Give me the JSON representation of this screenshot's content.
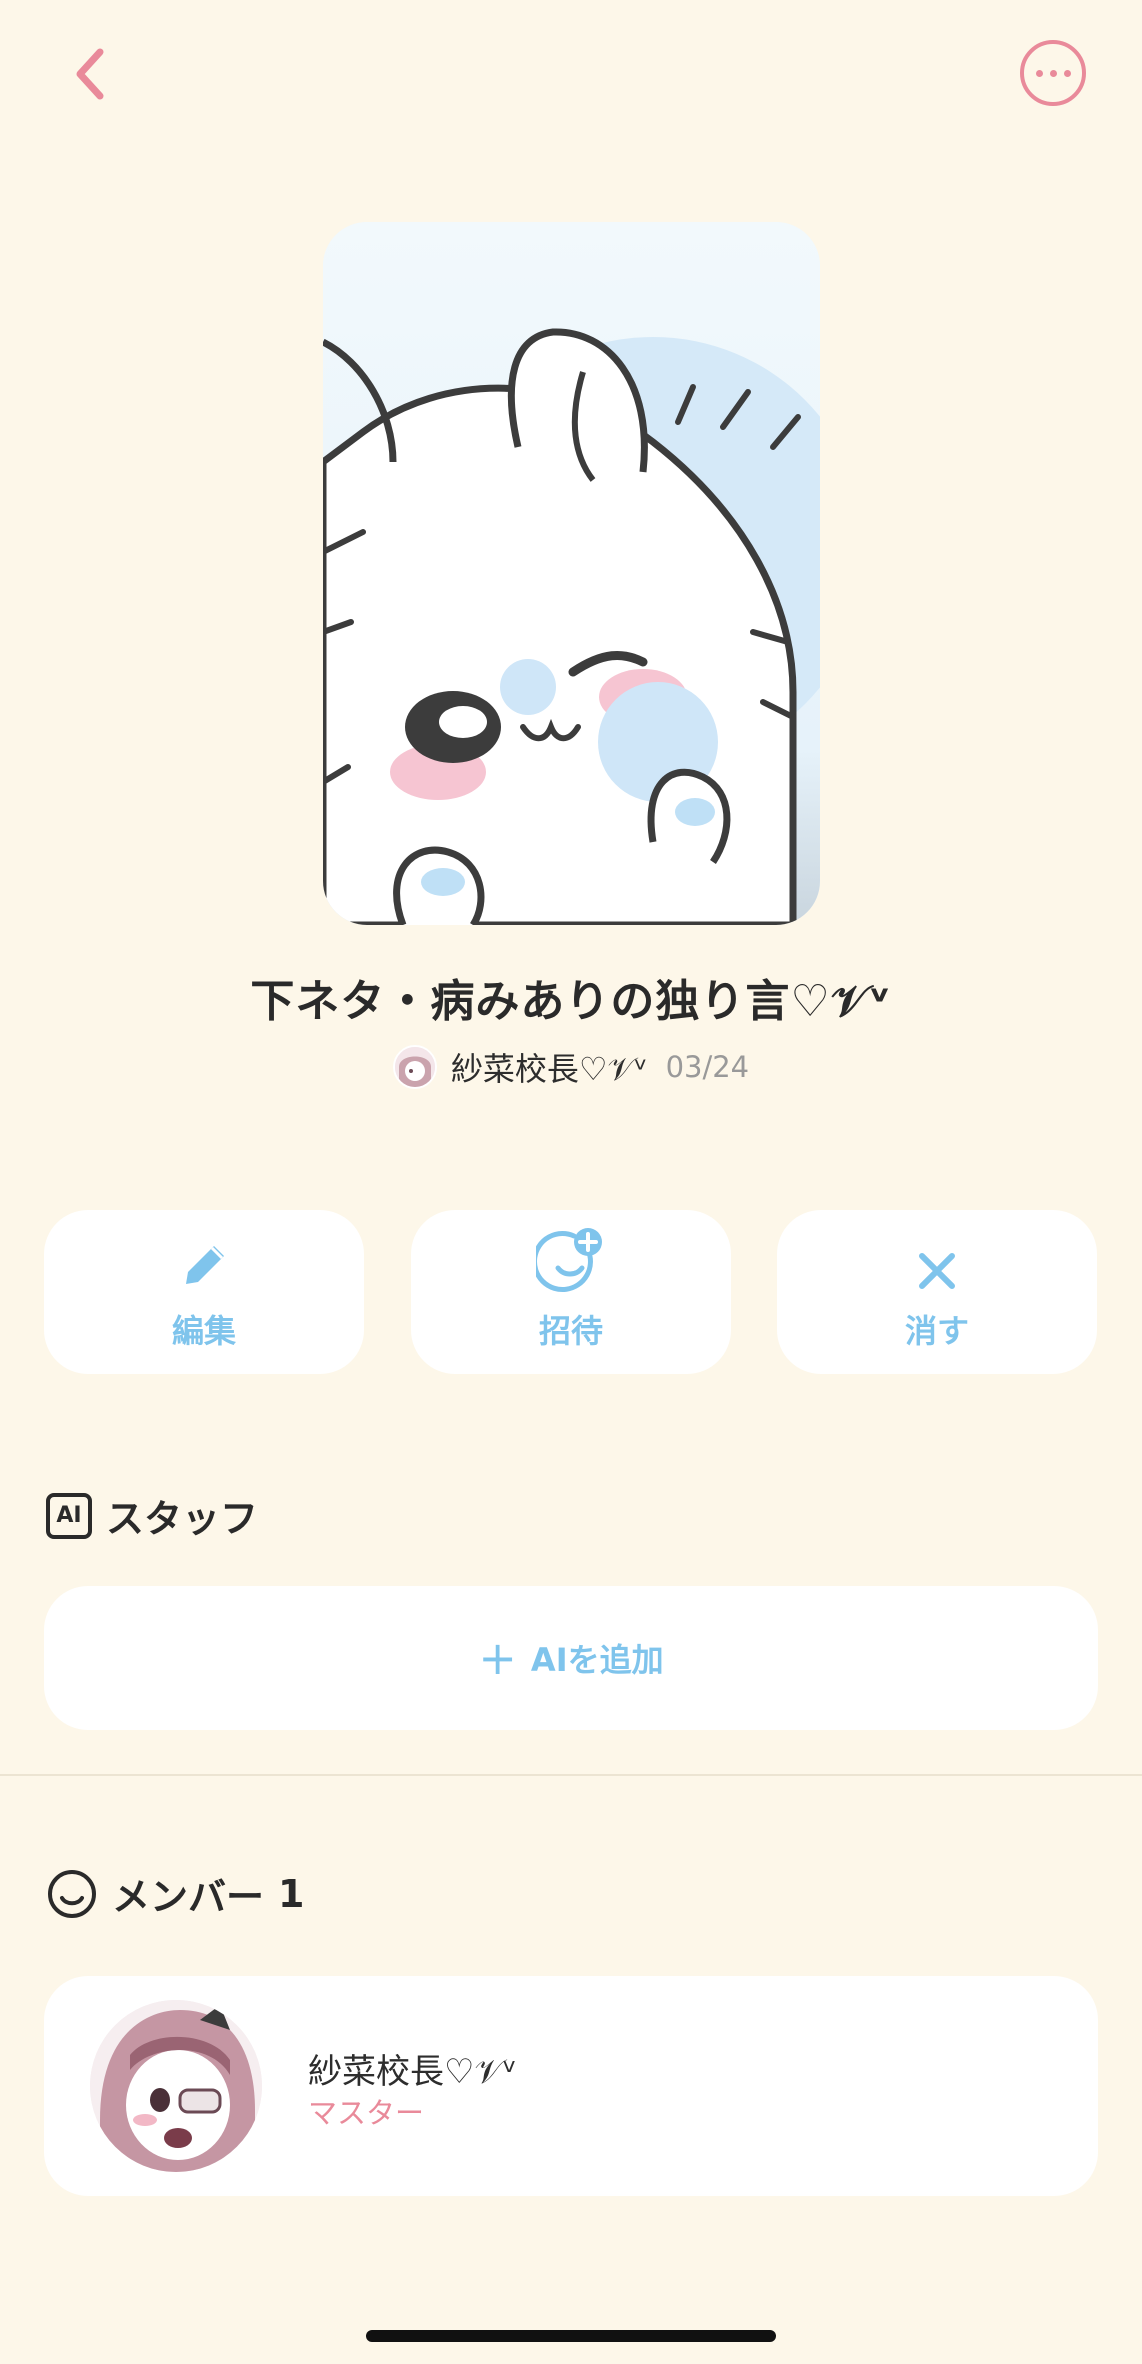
{
  "colors": {
    "background": "#fdf7e9",
    "accent_pink": "#e98a9a",
    "accent_blue": "#7fc4ec",
    "card": "#ffffff"
  },
  "header": {
    "back_icon": "chevron-left-icon",
    "more_icon": "more-horizontal-icon"
  },
  "room": {
    "title": "下ネタ・病みありの独り言♡𝒱ᵛ",
    "owner_name": "紗菜校長♡𝒱ᵛ",
    "date": "03/24"
  },
  "actions": [
    {
      "label": "編集",
      "icon": "pencil-icon"
    },
    {
      "label": "招待",
      "icon": "invite-icon"
    },
    {
      "label": "消す",
      "icon": "close-icon"
    }
  ],
  "staff": {
    "badge": "AI",
    "title": "スタッフ",
    "add_label": "AIを追加"
  },
  "members": {
    "title": "メンバー",
    "count": "1",
    "list": [
      {
        "name": "紗菜校長♡𝒱ᵛ",
        "role": "マスター"
      }
    ]
  }
}
